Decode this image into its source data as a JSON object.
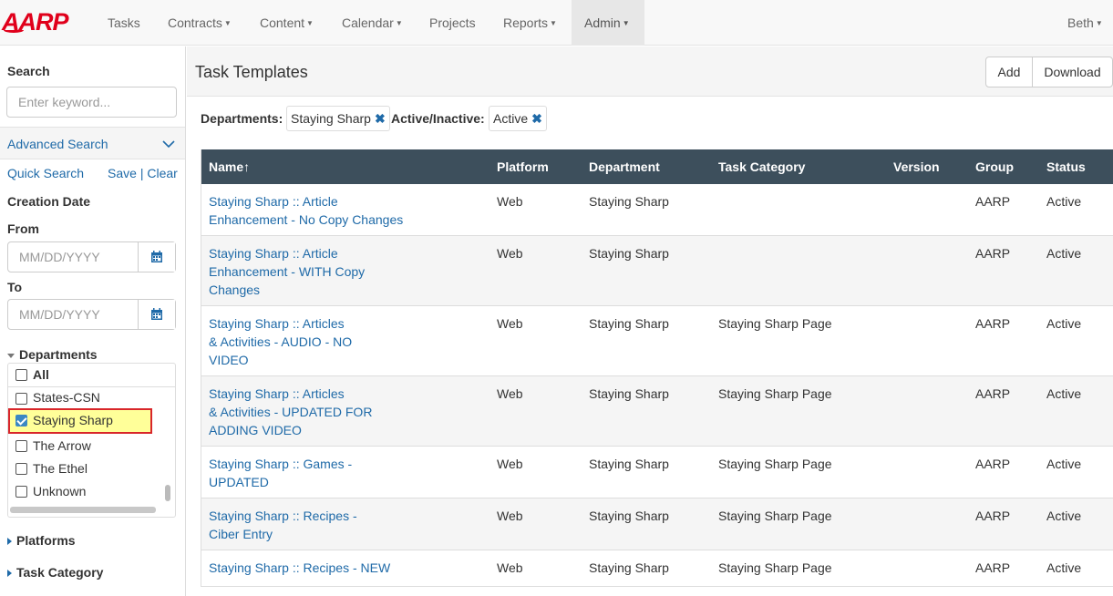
{
  "nav": {
    "logo": "AARP",
    "items": [
      {
        "label": "Tasks",
        "dropdown": false
      },
      {
        "label": "Contracts",
        "dropdown": true
      },
      {
        "label": "Content",
        "dropdown": true
      },
      {
        "label": "Calendar",
        "dropdown": true
      },
      {
        "label": "Projects",
        "dropdown": false
      },
      {
        "label": "Reports",
        "dropdown": true
      },
      {
        "label": "Admin",
        "dropdown": true
      }
    ],
    "user": "Beth"
  },
  "sidebar": {
    "search_label": "Search",
    "search_placeholder": "Enter keyword...",
    "advanced_search": "Advanced Search",
    "quick_search": "Quick Search",
    "save": "Save",
    "separator": "|",
    "clear": "Clear",
    "creation_date": "Creation Date",
    "from": "From",
    "to": "To",
    "date_placeholder": "MM/DD/YYYY",
    "departments_label": "Departments",
    "departments": [
      {
        "label": "All",
        "checked": false
      },
      {
        "label": "States-CSN",
        "checked": false
      },
      {
        "label": "Staying Sharp",
        "checked": true
      },
      {
        "label": "The Arrow",
        "checked": false
      },
      {
        "label": "The Ethel",
        "checked": false
      },
      {
        "label": "Unknown",
        "checked": false
      }
    ],
    "platforms_label": "Platforms",
    "task_category_label": "Task Category"
  },
  "main": {
    "title": "Task Templates",
    "add_button": "Add",
    "download_button": "Download",
    "filters": {
      "departments_label": "Departments:",
      "departments_value": "Staying Sharp",
      "active_label": "Active/Inactive:",
      "active_value": "Active"
    },
    "columns": [
      "Name↑",
      "Platform",
      "Department",
      "Task Category",
      "Version",
      "Group",
      "Status"
    ],
    "rows": [
      {
        "name_lines": [
          "Staying Sharp :: Article",
          "Enhancement - No Copy Changes"
        ],
        "platform": "Web",
        "department": "Staying Sharp",
        "category": "",
        "version": "",
        "group": "AARP",
        "status": "Active"
      },
      {
        "name_lines": [
          "Staying Sharp :: Article",
          "Enhancement - WITH Copy",
          "Changes"
        ],
        "platform": "Web",
        "department": "Staying Sharp",
        "category": "",
        "version": "",
        "group": "AARP",
        "status": "Active"
      },
      {
        "name_lines": [
          "Staying Sharp :: Articles",
          "& Activities - AUDIO - NO",
          "VIDEO"
        ],
        "platform": "Web",
        "department": "Staying Sharp",
        "category": "Staying Sharp Page",
        "version": "",
        "group": "AARP",
        "status": "Active"
      },
      {
        "name_lines": [
          "Staying Sharp :: Articles",
          "& Activities - UPDATED FOR",
          "ADDING VIDEO"
        ],
        "platform": "Web",
        "department": "Staying Sharp",
        "category": "Staying Sharp Page",
        "version": "",
        "group": "AARP",
        "status": "Active"
      },
      {
        "name_lines": [
          "Staying Sharp :: Games -",
          "UPDATED"
        ],
        "platform": "Web",
        "department": "Staying Sharp",
        "category": "Staying Sharp Page",
        "version": "",
        "group": "AARP",
        "status": "Active"
      },
      {
        "name_lines": [
          "Staying Sharp :: Recipes -",
          "Ciber Entry"
        ],
        "platform": "Web",
        "department": "Staying Sharp",
        "category": "Staying Sharp Page",
        "version": "",
        "group": "AARP",
        "status": "Active"
      },
      {
        "name_lines": [
          "Staying Sharp :: Recipes - NEW"
        ],
        "platform": "Web",
        "department": "Staying Sharp",
        "category": "Staying Sharp Page",
        "version": "",
        "group": "AARP",
        "status": "Active"
      }
    ]
  },
  "colors": {
    "accent": "#1f6aa8",
    "header_bg": "#3d4f5c",
    "brand": "#e0001b",
    "highlight": "#ffff99",
    "highlight_border": "#d8262a"
  }
}
